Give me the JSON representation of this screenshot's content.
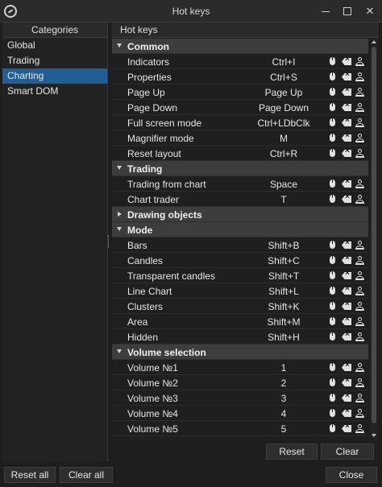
{
  "window": {
    "title": "Hot keys"
  },
  "categories": {
    "header": "Categories",
    "items": [
      {
        "label": "Global",
        "selected": false
      },
      {
        "label": "Trading",
        "selected": false
      },
      {
        "label": "Charting",
        "selected": true
      },
      {
        "label": "Smart DOM",
        "selected": false
      }
    ]
  },
  "hotkeys": {
    "header": "Hot keys",
    "rows": [
      {
        "type": "group",
        "label": "Common",
        "expanded": true
      },
      {
        "type": "item",
        "name": "Indicators",
        "key": "Ctrl+I"
      },
      {
        "type": "item",
        "name": "Properties",
        "key": "Ctrl+S"
      },
      {
        "type": "item",
        "name": "Page Up",
        "key": "Page Up"
      },
      {
        "type": "item",
        "name": "Page Down",
        "key": "Page Down"
      },
      {
        "type": "item",
        "name": "Full screen mode",
        "key": "Ctrl+LDbClk"
      },
      {
        "type": "item",
        "name": "Magnifier mode",
        "key": "M"
      },
      {
        "type": "item",
        "name": "Reset layout",
        "key": "Ctrl+R"
      },
      {
        "type": "group",
        "label": "Trading",
        "expanded": true
      },
      {
        "type": "item",
        "name": "Trading from chart",
        "key": "Space"
      },
      {
        "type": "item",
        "name": "Chart trader",
        "key": "T"
      },
      {
        "type": "group",
        "label": "Drawing objects",
        "expanded": false
      },
      {
        "type": "group",
        "label": "Mode",
        "expanded": true
      },
      {
        "type": "item",
        "name": "Bars",
        "key": "Shift+B"
      },
      {
        "type": "item",
        "name": "Candles",
        "key": "Shift+C"
      },
      {
        "type": "item",
        "name": "Transparent candles",
        "key": "Shift+T"
      },
      {
        "type": "item",
        "name": "Line Chart",
        "key": "Shift+L"
      },
      {
        "type": "item",
        "name": "Clusters",
        "key": "Shift+K"
      },
      {
        "type": "item",
        "name": "Area",
        "key": "Shift+M"
      },
      {
        "type": "item",
        "name": "Hidden",
        "key": "Shift+H"
      },
      {
        "type": "group",
        "label": "Volume selection",
        "expanded": true
      },
      {
        "type": "item",
        "name": "Volume №1",
        "key": "1"
      },
      {
        "type": "item",
        "name": "Volume №2",
        "key": "2"
      },
      {
        "type": "item",
        "name": "Volume №3",
        "key": "3"
      },
      {
        "type": "item",
        "name": "Volume №4",
        "key": "4"
      },
      {
        "type": "item",
        "name": "Volume №5",
        "key": "5"
      }
    ],
    "row_icons": [
      "mouse-icon",
      "clear-key-icon",
      "reset-default-icon"
    ]
  },
  "buttons": {
    "reset": "Reset",
    "clear": "Clear",
    "reset_all": "Reset all",
    "clear_all": "Clear all",
    "close": "Close"
  },
  "colors": {
    "selected_category": "#1f5f95",
    "group_row": "#3d3d3d",
    "background": "#1e1e1e"
  }
}
